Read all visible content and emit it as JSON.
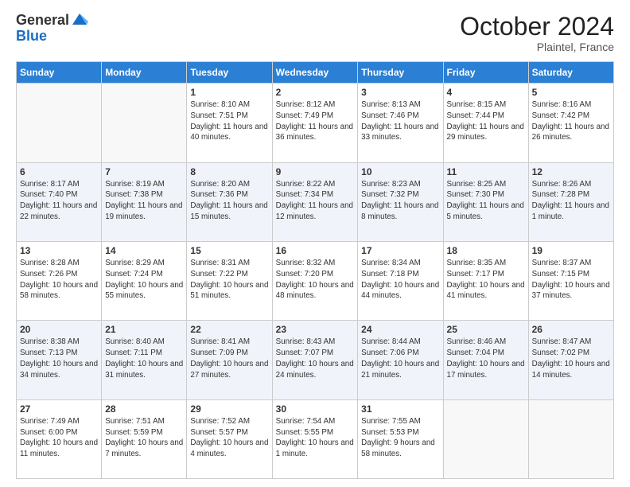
{
  "header": {
    "logo_general": "General",
    "logo_blue": "Blue",
    "month": "October 2024",
    "location": "Plaintel, France"
  },
  "weekdays": [
    "Sunday",
    "Monday",
    "Tuesday",
    "Wednesday",
    "Thursday",
    "Friday",
    "Saturday"
  ],
  "weeks": [
    [
      {
        "day": "",
        "sunrise": "",
        "sunset": "",
        "daylight": ""
      },
      {
        "day": "",
        "sunrise": "",
        "sunset": "",
        "daylight": ""
      },
      {
        "day": "1",
        "sunrise": "Sunrise: 8:10 AM",
        "sunset": "Sunset: 7:51 PM",
        "daylight": "Daylight: 11 hours and 40 minutes."
      },
      {
        "day": "2",
        "sunrise": "Sunrise: 8:12 AM",
        "sunset": "Sunset: 7:49 PM",
        "daylight": "Daylight: 11 hours and 36 minutes."
      },
      {
        "day": "3",
        "sunrise": "Sunrise: 8:13 AM",
        "sunset": "Sunset: 7:46 PM",
        "daylight": "Daylight: 11 hours and 33 minutes."
      },
      {
        "day": "4",
        "sunrise": "Sunrise: 8:15 AM",
        "sunset": "Sunset: 7:44 PM",
        "daylight": "Daylight: 11 hours and 29 minutes."
      },
      {
        "day": "5",
        "sunrise": "Sunrise: 8:16 AM",
        "sunset": "Sunset: 7:42 PM",
        "daylight": "Daylight: 11 hours and 26 minutes."
      }
    ],
    [
      {
        "day": "6",
        "sunrise": "Sunrise: 8:17 AM",
        "sunset": "Sunset: 7:40 PM",
        "daylight": "Daylight: 11 hours and 22 minutes."
      },
      {
        "day": "7",
        "sunrise": "Sunrise: 8:19 AM",
        "sunset": "Sunset: 7:38 PM",
        "daylight": "Daylight: 11 hours and 19 minutes."
      },
      {
        "day": "8",
        "sunrise": "Sunrise: 8:20 AM",
        "sunset": "Sunset: 7:36 PM",
        "daylight": "Daylight: 11 hours and 15 minutes."
      },
      {
        "day": "9",
        "sunrise": "Sunrise: 8:22 AM",
        "sunset": "Sunset: 7:34 PM",
        "daylight": "Daylight: 11 hours and 12 minutes."
      },
      {
        "day": "10",
        "sunrise": "Sunrise: 8:23 AM",
        "sunset": "Sunset: 7:32 PM",
        "daylight": "Daylight: 11 hours and 8 minutes."
      },
      {
        "day": "11",
        "sunrise": "Sunrise: 8:25 AM",
        "sunset": "Sunset: 7:30 PM",
        "daylight": "Daylight: 11 hours and 5 minutes."
      },
      {
        "day": "12",
        "sunrise": "Sunrise: 8:26 AM",
        "sunset": "Sunset: 7:28 PM",
        "daylight": "Daylight: 11 hours and 1 minute."
      }
    ],
    [
      {
        "day": "13",
        "sunrise": "Sunrise: 8:28 AM",
        "sunset": "Sunset: 7:26 PM",
        "daylight": "Daylight: 10 hours and 58 minutes."
      },
      {
        "day": "14",
        "sunrise": "Sunrise: 8:29 AM",
        "sunset": "Sunset: 7:24 PM",
        "daylight": "Daylight: 10 hours and 55 minutes."
      },
      {
        "day": "15",
        "sunrise": "Sunrise: 8:31 AM",
        "sunset": "Sunset: 7:22 PM",
        "daylight": "Daylight: 10 hours and 51 minutes."
      },
      {
        "day": "16",
        "sunrise": "Sunrise: 8:32 AM",
        "sunset": "Sunset: 7:20 PM",
        "daylight": "Daylight: 10 hours and 48 minutes."
      },
      {
        "day": "17",
        "sunrise": "Sunrise: 8:34 AM",
        "sunset": "Sunset: 7:18 PM",
        "daylight": "Daylight: 10 hours and 44 minutes."
      },
      {
        "day": "18",
        "sunrise": "Sunrise: 8:35 AM",
        "sunset": "Sunset: 7:17 PM",
        "daylight": "Daylight: 10 hours and 41 minutes."
      },
      {
        "day": "19",
        "sunrise": "Sunrise: 8:37 AM",
        "sunset": "Sunset: 7:15 PM",
        "daylight": "Daylight: 10 hours and 37 minutes."
      }
    ],
    [
      {
        "day": "20",
        "sunrise": "Sunrise: 8:38 AM",
        "sunset": "Sunset: 7:13 PM",
        "daylight": "Daylight: 10 hours and 34 minutes."
      },
      {
        "day": "21",
        "sunrise": "Sunrise: 8:40 AM",
        "sunset": "Sunset: 7:11 PM",
        "daylight": "Daylight: 10 hours and 31 minutes."
      },
      {
        "day": "22",
        "sunrise": "Sunrise: 8:41 AM",
        "sunset": "Sunset: 7:09 PM",
        "daylight": "Daylight: 10 hours and 27 minutes."
      },
      {
        "day": "23",
        "sunrise": "Sunrise: 8:43 AM",
        "sunset": "Sunset: 7:07 PM",
        "daylight": "Daylight: 10 hours and 24 minutes."
      },
      {
        "day": "24",
        "sunrise": "Sunrise: 8:44 AM",
        "sunset": "Sunset: 7:06 PM",
        "daylight": "Daylight: 10 hours and 21 minutes."
      },
      {
        "day": "25",
        "sunrise": "Sunrise: 8:46 AM",
        "sunset": "Sunset: 7:04 PM",
        "daylight": "Daylight: 10 hours and 17 minutes."
      },
      {
        "day": "26",
        "sunrise": "Sunrise: 8:47 AM",
        "sunset": "Sunset: 7:02 PM",
        "daylight": "Daylight: 10 hours and 14 minutes."
      }
    ],
    [
      {
        "day": "27",
        "sunrise": "Sunrise: 7:49 AM",
        "sunset": "Sunset: 6:00 PM",
        "daylight": "Daylight: 10 hours and 11 minutes."
      },
      {
        "day": "28",
        "sunrise": "Sunrise: 7:51 AM",
        "sunset": "Sunset: 5:59 PM",
        "daylight": "Daylight: 10 hours and 7 minutes."
      },
      {
        "day": "29",
        "sunrise": "Sunrise: 7:52 AM",
        "sunset": "Sunset: 5:57 PM",
        "daylight": "Daylight: 10 hours and 4 minutes."
      },
      {
        "day": "30",
        "sunrise": "Sunrise: 7:54 AM",
        "sunset": "Sunset: 5:55 PM",
        "daylight": "Daylight: 10 hours and 1 minute."
      },
      {
        "day": "31",
        "sunrise": "Sunrise: 7:55 AM",
        "sunset": "Sunset: 5:53 PM",
        "daylight": "Daylight: 9 hours and 58 minutes."
      },
      {
        "day": "",
        "sunrise": "",
        "sunset": "",
        "daylight": ""
      },
      {
        "day": "",
        "sunrise": "",
        "sunset": "",
        "daylight": ""
      }
    ]
  ]
}
